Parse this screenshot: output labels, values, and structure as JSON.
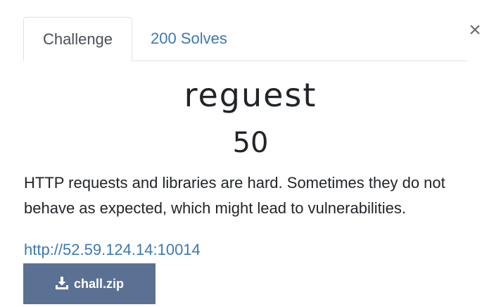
{
  "tabs": [
    {
      "label": "Challenge",
      "active": true
    },
    {
      "label": "200 Solves",
      "active": false
    }
  ],
  "close_label": "×",
  "challenge": {
    "name": "reguest",
    "points": "50",
    "description": "HTTP requests and libraries are hard. Sometimes they do not behave as expected, which might lead to vulnerabilities.",
    "url": "http://52.59.124.14:10014"
  },
  "files": [
    {
      "label": "chall.zip",
      "icon": "download-icon"
    }
  ],
  "colors": {
    "link": "#3c79b0",
    "button_bg": "#5b7193",
    "text": "#212529"
  }
}
